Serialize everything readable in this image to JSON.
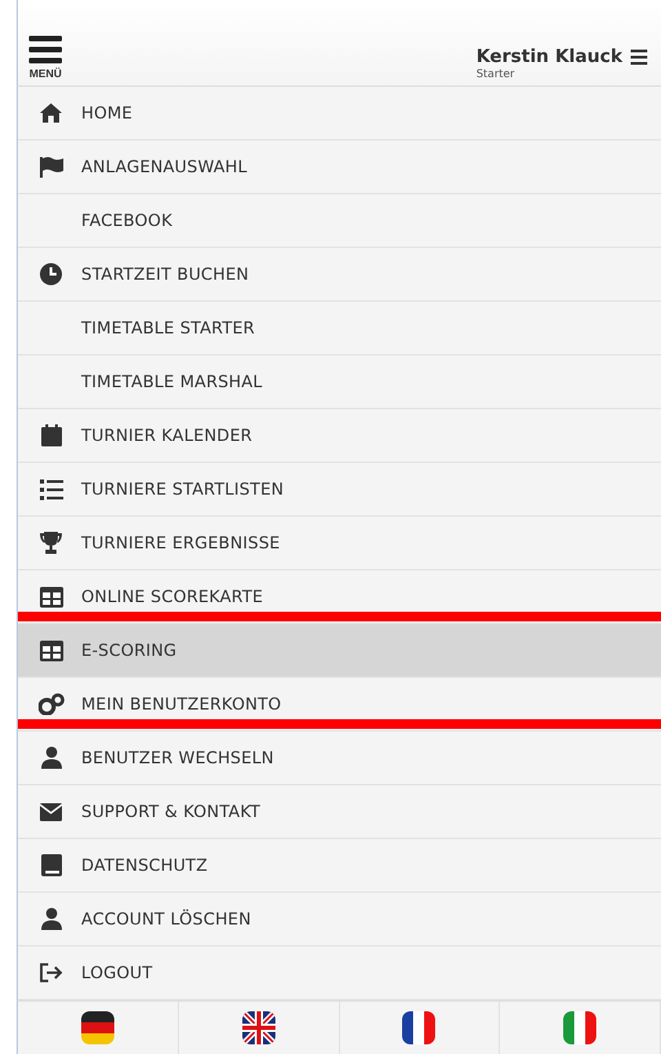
{
  "header": {
    "menu_label": "MENÜ",
    "user_name": "Kerstin Klauck",
    "user_role": "Starter"
  },
  "menu": [
    {
      "label": "HOME",
      "kind": "home",
      "selected": false,
      "crossed": false
    },
    {
      "label": "ANLAGENAUSWAHL",
      "kind": "flag",
      "selected": false,
      "crossed": false
    },
    {
      "label": "FACEBOOK",
      "kind": "plain",
      "selected": false,
      "crossed": false
    },
    {
      "label": "STARTZEIT BUCHEN",
      "kind": "clock",
      "selected": false,
      "crossed": false
    },
    {
      "label": "TIMETABLE STARTER",
      "kind": "plain",
      "selected": false,
      "crossed": false
    },
    {
      "label": "TIMETABLE MARSHAL",
      "kind": "plain",
      "selected": false,
      "crossed": false
    },
    {
      "label": "TURNIER KALENDER",
      "kind": "calendar",
      "selected": false,
      "crossed": false
    },
    {
      "label": "TURNIERE STARTLISTEN",
      "kind": "list",
      "selected": false,
      "crossed": false
    },
    {
      "label": "TURNIERE ERGEBNISSE",
      "kind": "trophy",
      "selected": false,
      "crossed": false
    },
    {
      "label": "ONLINE SCOREKARTE",
      "kind": "table",
      "selected": false,
      "crossed": true
    },
    {
      "label": "E-SCORING",
      "kind": "table",
      "selected": true,
      "crossed": false
    },
    {
      "label": "MEIN BENUTZERKONTO",
      "kind": "gears",
      "selected": false,
      "crossed": true
    },
    {
      "label": "BENUTZER WECHSELN",
      "kind": "user",
      "selected": false,
      "crossed": false
    },
    {
      "label": "SUPPORT & KONTAKT",
      "kind": "envelope",
      "selected": false,
      "crossed": false
    },
    {
      "label": "DATENSCHUTZ",
      "kind": "book",
      "selected": false,
      "crossed": false
    },
    {
      "label": "ACCOUNT LÖSCHEN",
      "kind": "user",
      "selected": false,
      "crossed": false
    },
    {
      "label": "LOGOUT",
      "kind": "logout",
      "selected": false,
      "crossed": false
    }
  ],
  "languages": [
    {
      "kind": "de"
    },
    {
      "kind": "gb"
    },
    {
      "kind": "fr"
    },
    {
      "kind": "it"
    }
  ]
}
